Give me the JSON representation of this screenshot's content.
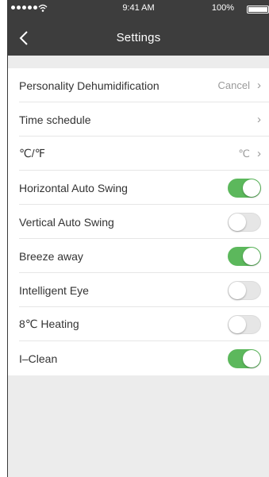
{
  "status_bar": {
    "time": "9:41 AM",
    "battery": "100%",
    "battery_level": 1.0
  },
  "nav": {
    "title": "Settings"
  },
  "colors": {
    "header_bg": "#3d3d3d",
    "toggle_on": "#5cb85c",
    "toggle_off": "#e6e6e6",
    "page_bg": "#ececec"
  },
  "settings": [
    {
      "label": "Personality Dehumidification",
      "value": "Cancel",
      "type": "link"
    },
    {
      "label": "Time schedule",
      "value": "",
      "type": "link"
    },
    {
      "label": "℃/℉",
      "value": "℃",
      "type": "link"
    },
    {
      "label": "Horizontal Auto Swing",
      "type": "toggle",
      "on": true
    },
    {
      "label": "Vertical Auto Swing",
      "type": "toggle",
      "on": false
    },
    {
      "label": "Breeze away",
      "type": "toggle",
      "on": true
    },
    {
      "label": "Intelligent Eye",
      "type": "toggle",
      "on": false
    },
    {
      "label": "8℃ Heating",
      "type": "toggle",
      "on": false
    },
    {
      "label": "I–Clean",
      "type": "toggle",
      "on": true
    }
  ]
}
